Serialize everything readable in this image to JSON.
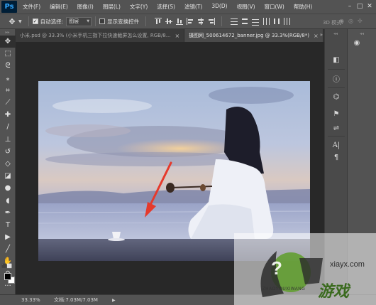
{
  "app": {
    "logo": "Ps"
  },
  "menu": {
    "items": [
      "文件(F)",
      "编辑(E)",
      "图像(I)",
      "图层(L)",
      "文字(Y)",
      "选择(S)",
      "滤镜(T)",
      "3D(D)",
      "视图(V)",
      "窗口(W)",
      "帮助(H)"
    ]
  },
  "window_controls": {
    "minimize": "–",
    "maximize": "□",
    "close": "✕"
  },
  "options": {
    "auto_select_label": "自动选择:",
    "auto_select_checked": "✓",
    "auto_select_value": "图层",
    "show_transform_label": "显示变换控件",
    "mode_3d_label": "3D 模式:"
  },
  "tabs": [
    {
      "label": "小米.psd @ 33.3% (小米手机三指下拉快速截屏怎么设置, RGB/8...",
      "close": "×",
      "active": false
    },
    {
      "label": "摄图网_500614672_banner.jpg @ 33.3%(RGB/8*)",
      "close": "×",
      "active": true
    }
  ],
  "tabs_more": "»",
  "tools": [
    {
      "name": "move-tool-icon",
      "glyph": "✥"
    },
    {
      "name": "marquee-tool-icon",
      "glyph": "⬚"
    },
    {
      "name": "lasso-tool-icon",
      "glyph": "ᘓ"
    },
    {
      "name": "magic-wand-tool-icon",
      "glyph": "⁎"
    },
    {
      "name": "crop-tool-icon",
      "glyph": "⌗"
    },
    {
      "name": "eyedropper-tool-icon",
      "glyph": "⟋"
    },
    {
      "name": "healing-brush-tool-icon",
      "glyph": "✚"
    },
    {
      "name": "brush-tool-icon",
      "glyph": "∕"
    },
    {
      "name": "clone-stamp-tool-icon",
      "glyph": "⊥"
    },
    {
      "name": "history-brush-tool-icon",
      "glyph": "↺"
    },
    {
      "name": "eraser-tool-icon",
      "glyph": "◇"
    },
    {
      "name": "paint-bucket-tool-icon",
      "glyph": "◪"
    },
    {
      "name": "blur-tool-icon",
      "glyph": "●"
    },
    {
      "name": "dodge-tool-icon",
      "glyph": "◖"
    },
    {
      "name": "pen-tool-icon",
      "glyph": "✒"
    },
    {
      "name": "type-tool-icon",
      "glyph": "T"
    },
    {
      "name": "path-selection-tool-icon",
      "glyph": "▶"
    },
    {
      "name": "line-tool-icon",
      "glyph": "╱"
    },
    {
      "name": "hand-tool-icon",
      "glyph": "✋"
    },
    {
      "name": "zoom-tool-icon",
      "glyph": "⚲"
    },
    {
      "name": "extra-tools-icon",
      "glyph": "···"
    }
  ],
  "right_panel": {
    "col1_icons": [
      "history-panel-icon",
      "info-panel-icon",
      "properties-panel-icon",
      "brush-panel-icon",
      "adjust-panel-icon",
      "character-panel-icon",
      "paragraph-panel-icon"
    ],
    "col2_icons": [
      "layers-panel-icon"
    ]
  },
  "status": {
    "zoom": "33.33%",
    "doc": "文档:7.03M/7.03M"
  },
  "watermark": {
    "brand_cn": "游戏",
    "brand_pinyin": "ZHAOYOUXIWANG",
    "site": "xiayx.com"
  },
  "colors": {
    "ui_dark": "#535353",
    "canvas_bg": "#282828",
    "arrow": "#e53a2c",
    "ps_blue": "#31a8ff"
  }
}
